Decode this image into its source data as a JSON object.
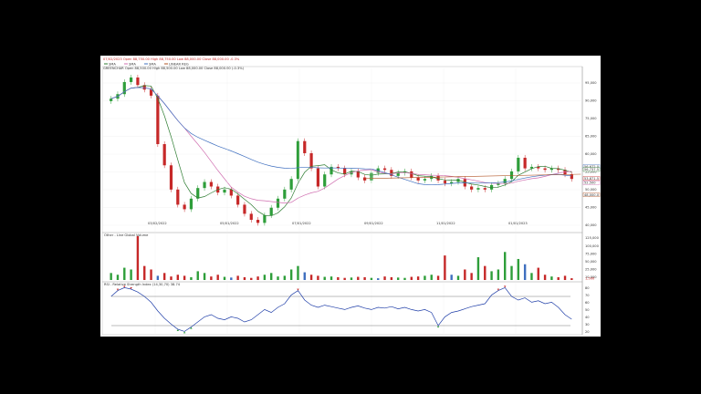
{
  "header": {
    "line1": "07/02/2023 Open 88,750.00 High 88,750.00 Low 88,000.00 Close 88,000.00 -0.3%",
    "legend": [
      "SMA",
      "SMA",
      "SMA",
      "LINEAR REG"
    ],
    "symbol_line": "GREENCHAR Open 88,500.00 High 88,500.00 Low 88,000.00 Close 88,000.00 (-0.3%)"
  },
  "colors": {
    "up": "#2e9e3a",
    "down": "#c62828",
    "sma_fast": "#2e7d32",
    "sma_mid": "#d06fb0",
    "sma_slow": "#3f6fbf",
    "line_reg": "#b05020",
    "rsi": "#1f3ea8"
  },
  "price_axis": [
    "95,000",
    "90,000",
    "75,000",
    "65,000",
    "60,000",
    "55,000",
    "50,000",
    "45,000",
    "40,000"
  ],
  "price_tags": [
    "56,672.0",
    "56,737.5",
    "53,871.5",
    "52,500",
    "48,000.0"
  ],
  "date_axis": [
    "03/02/2022",
    "05/01/2022",
    "07/01/2022",
    "09/01/2022",
    "11/01/2022",
    "01/01/2023"
  ],
  "volume_panel": {
    "title": "Other - Line Global Volume",
    "axis": [
      "125,000",
      "100,000",
      "75,000",
      "50,000",
      "25,000",
      "10,000"
    ],
    "last_value": "1,500"
  },
  "rsi_panel": {
    "title": "RSI - Relative Strength Index (14,30,70) 38.74",
    "axis": [
      "80",
      "70",
      "60",
      "50",
      "40",
      "30",
      "20"
    ]
  },
  "chart_data": [
    {
      "type": "candlestick",
      "title": "GREENCHAR",
      "x_ticks": [
        "03/02/2022",
        "05/01/2022",
        "07/01/2022",
        "09/01/2022",
        "11/01/2022",
        "01/01/2023"
      ],
      "ylim": [
        42000,
        95000
      ],
      "series": [
        {
          "name": "Close",
          "values": [
            85000,
            86500,
            90500,
            92000,
            89500,
            88000,
            86000,
            70000,
            63000,
            55000,
            50000,
            48500,
            52000,
            55500,
            57500,
            56000,
            54000,
            55000,
            53000,
            50000,
            47000,
            45000,
            44000,
            46500,
            49000,
            52000,
            55000,
            58500,
            71000,
            67000,
            62000,
            56000,
            60000,
            62500,
            62000,
            60000,
            61000,
            59000,
            58000,
            60500,
            62000,
            61500,
            59500,
            60500,
            61000,
            59000,
            58000,
            58500,
            59500,
            58000,
            57000,
            57500,
            58500,
            56000,
            55000,
            55500,
            55000,
            56500,
            57000,
            58500,
            61000,
            65500,
            62000,
            62500,
            62000,
            61500,
            62000,
            61500,
            60000,
            58500
          ]
        }
      ]
    },
    {
      "type": "bar",
      "title": "Other - Line Global Volume",
      "ylim": [
        0,
        125000
      ],
      "values": [
        20000,
        15000,
        35000,
        30000,
        125000,
        40000,
        30000,
        12000,
        20000,
        10000,
        15000,
        12000,
        8000,
        25000,
        20000,
        10000,
        15000,
        9000,
        7000,
        12000,
        8000,
        6000,
        10000,
        15000,
        20000,
        10000,
        12000,
        30000,
        40000,
        22000,
        15000,
        12000,
        9000,
        10000,
        8000,
        6000,
        7000,
        9000,
        8000,
        6000,
        5000,
        10000,
        8000,
        7000,
        6000,
        9000,
        10000,
        12000,
        15000,
        12000,
        70000,
        15000,
        12000,
        30000,
        20000,
        65000,
        40000,
        25000,
        30000,
        80000,
        40000,
        60000,
        45000,
        20000,
        35000,
        15000,
        10000,
        8000,
        12000,
        5000
      ]
    },
    {
      "type": "line",
      "title": "RSI - Relative Strength Index (14,30,70) 38.74",
      "ylim": [
        20,
        85
      ],
      "values": [
        70,
        78,
        82,
        80,
        76,
        70,
        62,
        50,
        40,
        32,
        25,
        22,
        28,
        35,
        42,
        45,
        40,
        38,
        42,
        40,
        35,
        38,
        45,
        52,
        48,
        55,
        60,
        72,
        78,
        65,
        58,
        55,
        58,
        56,
        54,
        52,
        55,
        57,
        54,
        52,
        55,
        54,
        56,
        53,
        55,
        52,
        50,
        52,
        48,
        30,
        42,
        48,
        50,
        53,
        56,
        58,
        60,
        72,
        78,
        82,
        70,
        65,
        68,
        62,
        64,
        60,
        62,
        55,
        45,
        38.74
      ]
    }
  ]
}
